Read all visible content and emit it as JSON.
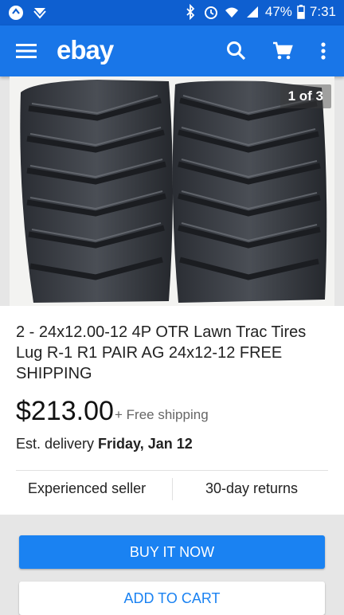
{
  "status_bar": {
    "battery": "47%",
    "time": "7:31",
    "icons": [
      "sync-icon",
      "mail-icon",
      "bluetooth-icon",
      "alarm-icon",
      "wifi-icon",
      "signal-icon",
      "battery-icon"
    ]
  },
  "app_bar": {
    "logo": "ebay",
    "icons": [
      "menu-icon",
      "search-icon",
      "cart-icon",
      "more-vert-icon"
    ]
  },
  "gallery": {
    "counter": "1 of 3"
  },
  "listing": {
    "title": "2 - 24x12.00-12 4P OTR Lawn Trac Tires Lug R-1 R1 PAIR AG 24x12-12 FREE SHIPPING",
    "price": "$213.00",
    "shipping": "+ Free shipping",
    "delivery_prefix": "Est. delivery ",
    "delivery_date": "Friday, Jan 12",
    "features": [
      "Experienced seller",
      "30-day returns"
    ]
  },
  "actions": {
    "buy_now": "BUY IT NOW",
    "add_to_cart": "ADD TO CART"
  },
  "colors": {
    "status_bar": "#0e5fd0",
    "app_bar": "#1976e8",
    "buy_button": "#1a82f2"
  }
}
